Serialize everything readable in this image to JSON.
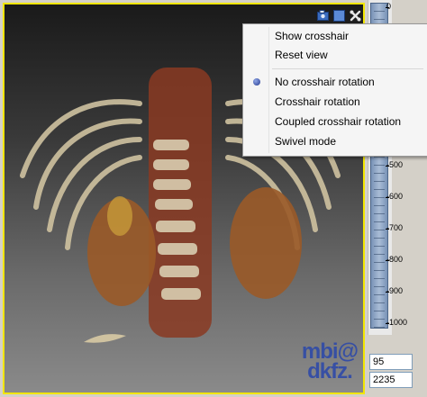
{
  "viewer": {
    "toolbar_icons": [
      "screenshot-icon",
      "layout-icon",
      "tools-icon"
    ],
    "watermark_line1": "mbi@",
    "watermark_line2": "dkfz.",
    "border_color": "#f2e600"
  },
  "context_menu": {
    "items": [
      {
        "label": "Show crosshair",
        "selected": false
      },
      {
        "label": "Reset view",
        "selected": false
      },
      {
        "label": "No crosshair rotation",
        "selected": true
      },
      {
        "label": "Crosshair rotation",
        "selected": false
      },
      {
        "label": "Coupled crosshair rotation",
        "selected": false
      },
      {
        "label": "Swivel mode",
        "selected": false
      }
    ]
  },
  "level_window": {
    "scale_labels": [
      "0",
      "-500",
      "-600",
      "-700",
      "-800",
      "-900",
      "-1000"
    ],
    "level": "95",
    "window": "2235"
  }
}
